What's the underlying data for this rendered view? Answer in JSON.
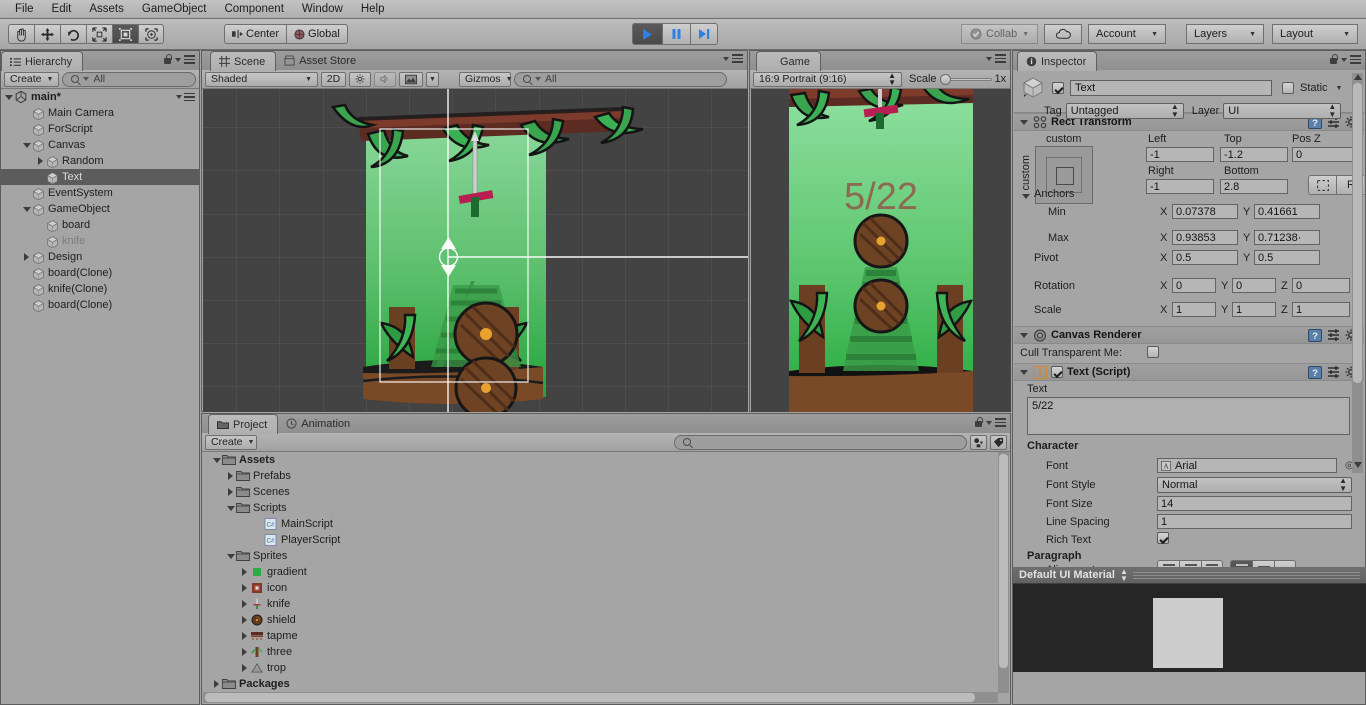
{
  "menubar": {
    "items": [
      "File",
      "Edit",
      "Assets",
      "GameObject",
      "Component",
      "Window",
      "Help"
    ]
  },
  "toolbar": {
    "tools": [
      {
        "name": "hand-tool",
        "glyph": "hand",
        "active": false
      },
      {
        "name": "move-tool",
        "glyph": "move",
        "active": false
      },
      {
        "name": "rotate-tool",
        "glyph": "rotate",
        "active": false
      },
      {
        "name": "scale-tool",
        "glyph": "scale",
        "active": false
      },
      {
        "name": "rect-tool",
        "glyph": "rect",
        "active": true
      },
      {
        "name": "transform-tool",
        "glyph": "transform",
        "active": false
      }
    ],
    "pivot_mode": "Center",
    "pivot_rotation": "Global",
    "play": "▶",
    "pause": "‖",
    "step": "▶|",
    "collab": "Collab",
    "account": "Account",
    "layers": "Layers",
    "layout": "Layout"
  },
  "hierarchy": {
    "tab": "Hierarchy",
    "create": "Create",
    "search_placeholder": "All",
    "scene_name": "main*",
    "items": [
      {
        "label": "Main Camera",
        "depth": 1,
        "arrow": "none",
        "state": "normal"
      },
      {
        "label": "ForScript",
        "depth": 1,
        "arrow": "none",
        "state": "normal"
      },
      {
        "label": "Canvas",
        "depth": 1,
        "arrow": "down",
        "state": "normal"
      },
      {
        "label": "Random",
        "depth": 2,
        "arrow": "right",
        "state": "normal"
      },
      {
        "label": "Text",
        "depth": 2,
        "arrow": "none",
        "state": "selected"
      },
      {
        "label": "EventSystem",
        "depth": 1,
        "arrow": "none",
        "state": "normal"
      },
      {
        "label": "GameObject",
        "depth": 1,
        "arrow": "down",
        "state": "normal"
      },
      {
        "label": "board",
        "depth": 2,
        "arrow": "none",
        "state": "normal"
      },
      {
        "label": "knife",
        "depth": 2,
        "arrow": "none",
        "state": "dim"
      },
      {
        "label": "Design",
        "depth": 1,
        "arrow": "right",
        "state": "normal"
      },
      {
        "label": "board(Clone)",
        "depth": 1,
        "arrow": "none",
        "state": "normal"
      },
      {
        "label": "knife(Clone)",
        "depth": 1,
        "arrow": "none",
        "state": "normal"
      },
      {
        "label": "board(Clone)",
        "depth": 1,
        "arrow": "none",
        "state": "normal"
      }
    ]
  },
  "scene": {
    "tabs": [
      {
        "label": "Scene",
        "active": true,
        "icon": "grid-icon"
      },
      {
        "label": "Asset Store",
        "active": false,
        "icon": "store-icon"
      }
    ],
    "draw_mode": "Shaded",
    "mode_2d": "2D",
    "gizmos": "Gizmos",
    "search_placeholder": "All"
  },
  "game": {
    "tab": "Game",
    "aspect": "16:9 Portrait (9:16)",
    "scale_label": "Scale",
    "scale_value": "1x",
    "score_text": "5/22"
  },
  "project": {
    "tabs": [
      {
        "label": "Project",
        "active": true,
        "icon": "folder-icon"
      },
      {
        "label": "Animation",
        "active": false,
        "icon": "clock-icon"
      }
    ],
    "create": "Create",
    "search_placeholder": "",
    "items": [
      {
        "label": "Assets",
        "depth": 0,
        "arrow": "down",
        "icon": "folder",
        "bold": true
      },
      {
        "label": "Prefabs",
        "depth": 1,
        "arrow": "right",
        "icon": "folder",
        "bold": false
      },
      {
        "label": "Scenes",
        "depth": 1,
        "arrow": "right",
        "icon": "folder",
        "bold": false
      },
      {
        "label": "Scripts",
        "depth": 1,
        "arrow": "down",
        "icon": "folder",
        "bold": false
      },
      {
        "label": "MainScript",
        "depth": 3,
        "arrow": "none",
        "icon": "csharp",
        "bold": false
      },
      {
        "label": "PlayerScript",
        "depth": 3,
        "arrow": "none",
        "icon": "csharp",
        "bold": false
      },
      {
        "label": "Sprites",
        "depth": 1,
        "arrow": "down",
        "icon": "folder",
        "bold": false
      },
      {
        "label": "gradient",
        "depth": 2,
        "arrow": "right",
        "icon": "sprite-gradient",
        "bold": false
      },
      {
        "label": "icon",
        "depth": 2,
        "arrow": "right",
        "icon": "sprite-icon",
        "bold": false
      },
      {
        "label": "knife",
        "depth": 2,
        "arrow": "right",
        "icon": "sprite-knife",
        "bold": false
      },
      {
        "label": "shield",
        "depth": 2,
        "arrow": "right",
        "icon": "sprite-shield",
        "bold": false
      },
      {
        "label": "tapme",
        "depth": 2,
        "arrow": "right",
        "icon": "sprite-tapme",
        "bold": false
      },
      {
        "label": "three",
        "depth": 2,
        "arrow": "right",
        "icon": "sprite-three",
        "bold": false
      },
      {
        "label": "trop",
        "depth": 2,
        "arrow": "right",
        "icon": "sprite-trop",
        "bold": false
      },
      {
        "label": "Packages",
        "depth": 0,
        "arrow": "right",
        "icon": "folder",
        "bold": true
      }
    ]
  },
  "inspector": {
    "tab": "Inspector",
    "object_name": "Text",
    "object_enabled": true,
    "static_label": "Static",
    "static_checked": false,
    "tag_label": "Tag",
    "tag_value": "Untagged",
    "layer_label": "Layer",
    "layer_value": "UI",
    "rect_transform": {
      "title": "Rect Transform",
      "anchor_preset": "custom",
      "anchor_preset_vertical": "custom",
      "fields": [
        {
          "label": "Left",
          "value": "-1"
        },
        {
          "label": "Top",
          "value": "-1.2"
        },
        {
          "label": "Pos Z",
          "value": "0"
        },
        {
          "label": "Right",
          "value": "-1"
        },
        {
          "label": "Bottom",
          "value": "2.8"
        }
      ],
      "blueprint_btn": "",
      "raw_btn": "R",
      "anchors_label": "Anchors",
      "min_label": "Min",
      "min_x": "0.07378",
      "min_y": "0.41661",
      "max_label": "Max",
      "max_x": "0.93853",
      "max_y": "0.71238·",
      "pivot_label": "Pivot",
      "pivot_x": "0.5",
      "pivot_y": "0.5",
      "rotation_label": "Rotation",
      "rot_x": "0",
      "rot_y": "0",
      "rot_z": "0",
      "scale_label": "Scale",
      "scale_x": "1",
      "scale_y": "1",
      "scale_z": "1"
    },
    "canvas_renderer": {
      "title": "Canvas Renderer",
      "cull_label": "Cull Transparent Me:",
      "cull_checked": false
    },
    "text_script": {
      "title": "Text (Script)",
      "enabled": true,
      "text_label": "Text",
      "text_value": "5/22",
      "character_header": "Character",
      "font_label": "Font",
      "font_value": "Arial",
      "font_style_label": "Font Style",
      "font_style_value": "Normal",
      "font_size_label": "Font Size",
      "font_size_value": "14",
      "line_spacing_label": "Line Spacing",
      "line_spacing_value": "1",
      "rich_text_label": "Rich Text",
      "rich_text_checked": true,
      "paragraph_header": "Paragraph",
      "alignment_label": "Alignment"
    },
    "material_preview": {
      "title": "Default UI Material"
    }
  },
  "colors": {
    "chrome": "#a5a5a5",
    "panel_dark": "#434343",
    "selection": "#5c5c5c",
    "play_blue": "#2f7fe8",
    "accent_orange": "#d08a2c"
  }
}
